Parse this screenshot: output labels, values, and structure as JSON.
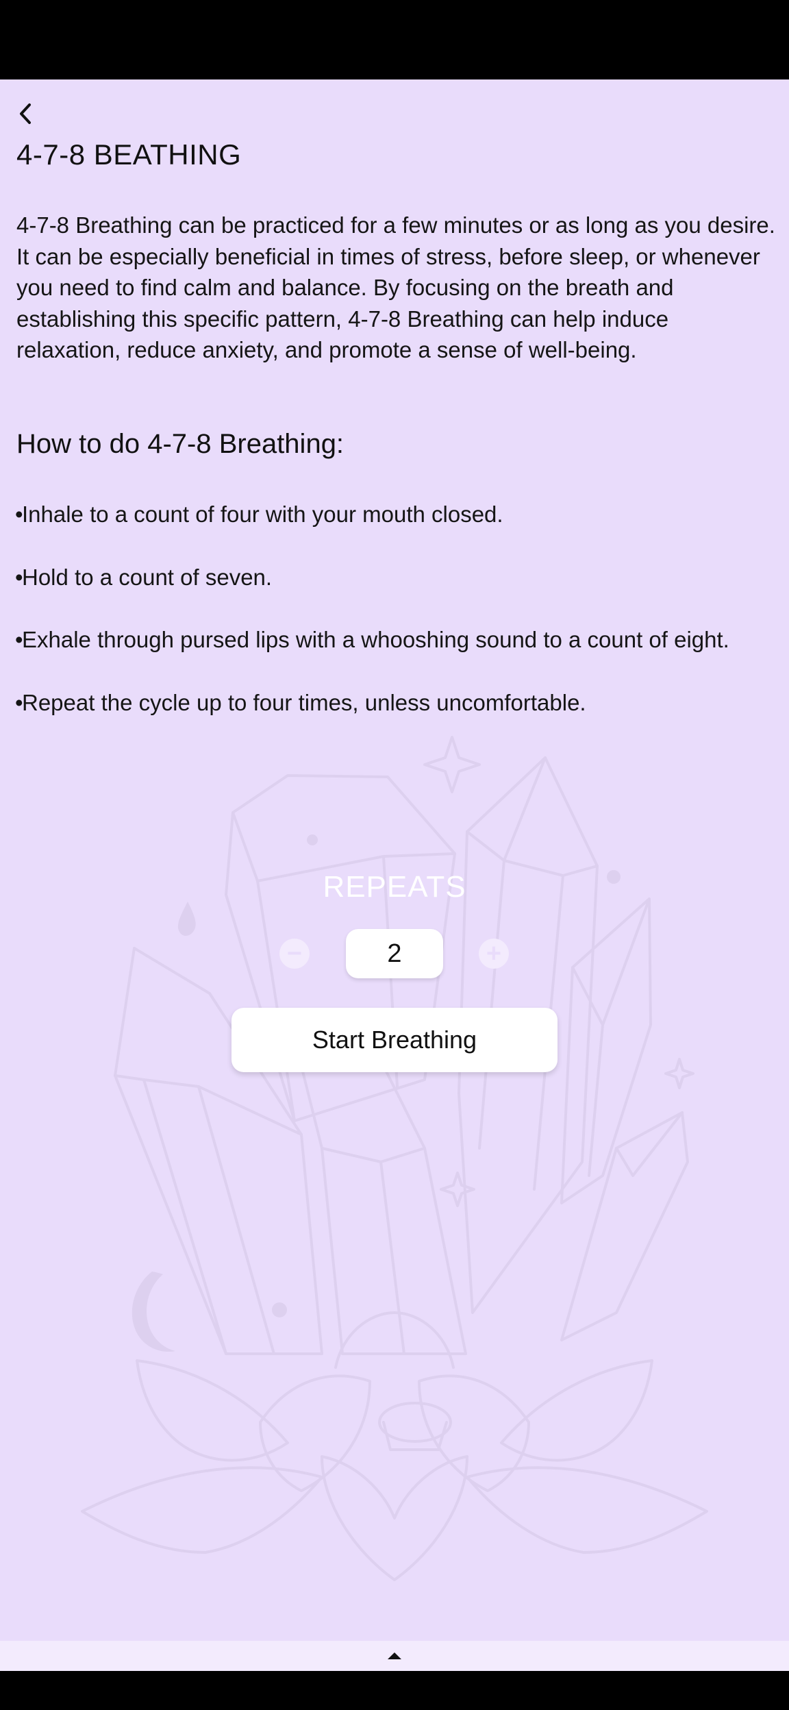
{
  "app": {
    "title": "4-7-8 BEATHING"
  },
  "intro": {
    "text": "4-7-8 Breathing can be practiced for a few minutes or as long as you desire. It can be especially beneficial in times of stress, before sleep, or whenever you need to find calm and balance. By focusing on the breath and establishing this specific pattern, 4-7-8 Breathing can help induce relaxation, reduce anxiety, and promote a sense of well-being."
  },
  "how_to": {
    "heading": "How to do 4-7-8 Breathing:",
    "bullet": "•",
    "steps": [
      "Inhale to a count of four with your mouth closed.",
      "Hold to a count of seven.",
      "Exhale through pursed lips with a whooshing sound to a count of eight.",
      "Repeat the cycle up to four times, unless uncomfortable."
    ]
  },
  "repeats": {
    "label": "REPEATS",
    "value": "2",
    "decrement_symbol": "−",
    "increment_symbol": "+"
  },
  "actions": {
    "start_label": "Start Breathing"
  },
  "icons": {
    "back": "chevron-left-icon",
    "decrement": "minus-circle-icon",
    "increment": "plus-circle-icon",
    "expand": "caret-up-icon",
    "background": "crystal-lotus-illustration"
  },
  "colors": {
    "background": "#e9dcfb",
    "art_line": "#ddd0ef",
    "card": "#ffffff",
    "text": "#111111",
    "label_white": "#ffffff"
  }
}
